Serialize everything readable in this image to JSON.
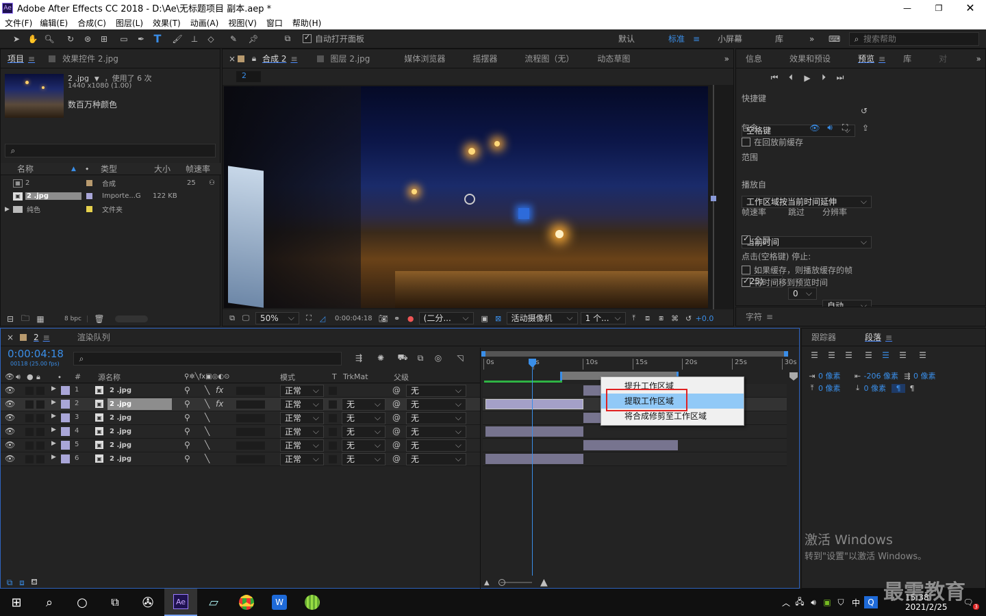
{
  "app": {
    "title": "Adobe After Effects CC 2018 - D:\\Ae\\无标题项目 副本.aep *",
    "logo": "Ae"
  },
  "menu": [
    "文件(F)",
    "编辑(E)",
    "合成(C)",
    "图层(L)",
    "效果(T)",
    "动画(A)",
    "视图(V)",
    "窗口",
    "帮助(H)"
  ],
  "toolbar": {
    "auto_open": "自动打开面板",
    "workspaces": [
      "默认",
      "标准",
      "小屏幕",
      "库"
    ],
    "search_placeholder": "搜索帮助"
  },
  "project": {
    "tabs": [
      "项目",
      "效果控件 2.jpg"
    ],
    "item_name": "2 .jpg",
    "used": "，使用了 6 次",
    "dims": "1440 x1080 (1.00)",
    "colors": "数百万种颜色",
    "cols": [
      "名称",
      "类型",
      "大小",
      "帧速率"
    ],
    "items": [
      {
        "name": "2",
        "type": "合成",
        "size": "",
        "fps": "25",
        "color": "#b89a6e"
      },
      {
        "name": "2 .jpg",
        "type": "Importe...G",
        "size": "122 KB",
        "fps": "",
        "color": "#a9a6d8"
      },
      {
        "name": "纯色",
        "type": "文件夹",
        "size": "",
        "fps": "",
        "color": "#e6d14d"
      }
    ],
    "bpc": "8 bpc"
  },
  "viewer": {
    "tabs": [
      "合成 2",
      "图层 2.jpg",
      "媒体浏览器",
      "摇摆器",
      "流程图（无）",
      "动态草图"
    ],
    "comp_label": "2",
    "zoom": "50%",
    "timecode": "0:00:04:18",
    "resolution": "(二分...",
    "camera": "活动摄像机",
    "views": "1 个...",
    "exposure": "+0.0"
  },
  "preview": {
    "tabs": [
      "信息",
      "效果和预设",
      "预览",
      "库",
      "对"
    ],
    "shortcut_label": "快捷键",
    "shortcut": "空格键",
    "include": "包含:",
    "cache_before": "在回放前缓存",
    "range_label": "范围",
    "range": "工作区域按当前时间延伸",
    "play_from_label": "播放自",
    "play_from": "当前时间",
    "fps_label": "帧速率",
    "skip_label": "跳过",
    "res_label": "分辨率",
    "fps": "(25)",
    "skip": "0",
    "res": "自动",
    "fullscreen": "全屏",
    "stop_label": "点击(空格键) 停止:",
    "if_cache": "如果缓存，则播放缓存的帧",
    "move_time": "将时间移到预览时间",
    "char_tab": "字符"
  },
  "timeline": {
    "tabs": [
      "2",
      "渲染队列"
    ],
    "timecode": "0:00:04:18",
    "frames": "00118 (25.00 fps)",
    "cols": {
      "num": "#",
      "source": "源名称",
      "mode": "模式",
      "t": "T",
      "trk": "TrkMat",
      "parent": "父级"
    },
    "ruler": [
      "0s",
      "s",
      "10s",
      "15s",
      "20s",
      "25s",
      "30s"
    ],
    "layers": [
      {
        "num": "1",
        "name": "2 .jpg",
        "mode": "正常",
        "trk": "",
        "parent": "无",
        "bar_start": 0.322,
        "bar_end": 0.634
      },
      {
        "num": "2",
        "name": "2 .jpg",
        "mode": "正常",
        "trk": "无",
        "parent": "无",
        "bar_start": 0.0,
        "bar_end": 0.322
      },
      {
        "num": "3",
        "name": "2 .jpg",
        "mode": "正常",
        "trk": "无",
        "parent": "无",
        "bar_start": 0.322,
        "bar_end": 0.634
      },
      {
        "num": "4",
        "name": "2 .jpg",
        "mode": "正常",
        "trk": "无",
        "parent": "无",
        "bar_start": 0.0,
        "bar_end": 0.322
      },
      {
        "num": "5",
        "name": "2 .jpg",
        "mode": "正常",
        "trk": "无",
        "parent": "无",
        "bar_start": 0.322,
        "bar_end": 0.634
      },
      {
        "num": "6",
        "name": "2 .jpg",
        "mode": "正常",
        "trk": "无",
        "parent": "无",
        "bar_start": 0.0,
        "bar_end": 0.322
      }
    ]
  },
  "context_menu": [
    "提升工作区域",
    "提取工作区域",
    "将合成修剪至工作区域"
  ],
  "paragraph": {
    "tabs": [
      "跟踪器",
      "段落"
    ],
    "indent1": "0 像素",
    "indent2": "-206 像素",
    "indent3": "0 像素",
    "space1": "0 像素",
    "space2": "0 像素"
  },
  "watermark": {
    "line1": "激活 Windows",
    "line2": "转到\"设置\"以激活 Windows。",
    "brand": "最需教育"
  },
  "taskbar": {
    "time": "15:38",
    "date": "2021/2/25",
    "ime": "中",
    "notif": "3"
  }
}
